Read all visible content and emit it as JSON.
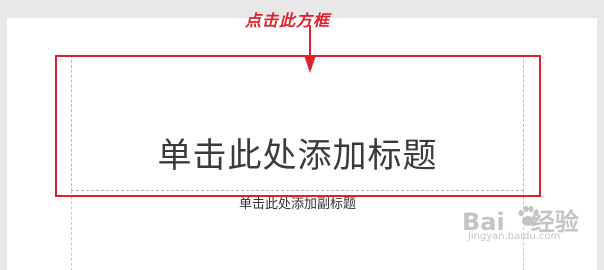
{
  "annotation": {
    "text": "点击此方框",
    "color": "#e0202a"
  },
  "slide": {
    "title_placeholder": "单击此处添加标题",
    "subtitle_placeholder": "单击此处添加副标题"
  },
  "watermark": {
    "logo_left": "Bai",
    "logo_right": "经验",
    "url": "jingyan.baidu.com"
  }
}
